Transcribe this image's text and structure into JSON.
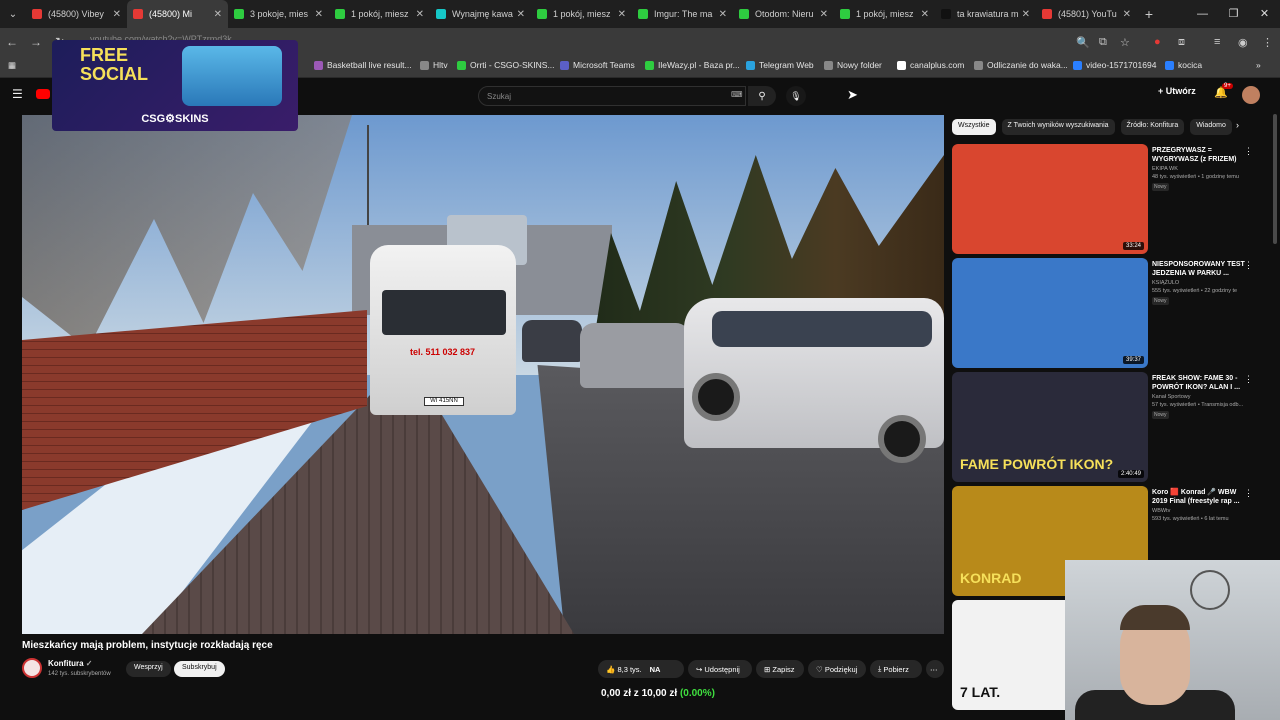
{
  "tabs": [
    {
      "label": "(45800) Vibey",
      "color": "#e53935"
    },
    {
      "label": "(45800) Mi",
      "color": "#e53935",
      "active": true
    },
    {
      "label": "3 pokoje, mies",
      "color": "#2ecc40"
    },
    {
      "label": "1 pokój, miesz",
      "color": "#2ecc40"
    },
    {
      "label": "Wynajmę kawa",
      "color": "#16c7c7"
    },
    {
      "label": "1 pokój, miesz",
      "color": "#2ecc40"
    },
    {
      "label": "Imgur: The ma",
      "color": "#2ecc40"
    },
    {
      "label": "Otodom: Nieru",
      "color": "#2ecc40"
    },
    {
      "label": "1 pokój, miesz",
      "color": "#2ecc40"
    },
    {
      "label": "ta krawiatura m",
      "color": "#111111"
    },
    {
      "label": "(45801) YouTu",
      "color": "#e53935"
    }
  ],
  "address": {
    "url": "youtube.com/watch?v=WPTzrmd3k"
  },
  "bookmarks": [
    {
      "label": "Basketball live result...",
      "color": "#9b59b6"
    },
    {
      "label": "Hltv",
      "color": "#888888"
    },
    {
      "label": "Orrti - CSGO-SKINS...",
      "color": "#2ecc40"
    },
    {
      "label": "Microsoft Teams",
      "color": "#5b5fc7"
    },
    {
      "label": "IleWazy.pl - Baza pr...",
      "color": "#2ecc40"
    },
    {
      "label": "Telegram Web",
      "color": "#2aa3df"
    },
    {
      "label": "Nowy folder",
      "color": "#888888"
    },
    {
      "label": "canalplus.com",
      "color": "#ffffff"
    },
    {
      "label": "Odliczanie do waka...",
      "color": "#888888"
    },
    {
      "label": "video-1571701694",
      "color": "#2a7fff"
    },
    {
      "label": "kocica",
      "color": "#2a7fff"
    }
  ],
  "header": {
    "search_placeholder": "Szukaj",
    "create_label": "Utwórz",
    "notif_count": "9+"
  },
  "video": {
    "title": "Mieszkańcy mają problem, instytucje rozkładają ręce",
    "channel": "Konfitura",
    "subs": "142 tys. subskrybentów",
    "support_label": "Wesprzyj",
    "subscribe_label": "Subskrybuj",
    "likes": "8,3 tys.",
    "share_label": "Udostępnij",
    "save_label": "Zapisz",
    "thanks_label": "Podziękuj",
    "download_label": "Pobierz",
    "van_phone": "tel. 511 032 837",
    "plate": "WI 415NN"
  },
  "donation": {
    "text": "0,00 zł z 10,00 zł",
    "pct": "(0.00%)"
  },
  "chips": [
    "Wszystkie",
    "Z Twoich wyników wyszukiwania",
    "Źródło: Konfitura",
    "Wiadomo"
  ],
  "recs": [
    {
      "title": "PRZEGRYWASZ = WYGRYWASZ (z FRIZEM)",
      "channel": "EKIPA WK",
      "meta": "48 tys. wyświetleń • 1 godzinę temu",
      "new": "Nowy",
      "dur": "33:24",
      "color": "#d9462f"
    },
    {
      "title": "NIESPONSOROWANY TEST JEDZENIA W PARKU ...",
      "channel": "KSIĄŻULO",
      "meta": "555 tys. wyświetleń • 22 godziny te",
      "new": "Nowy",
      "dur": "39:37",
      "color": "#3a78c8"
    },
    {
      "title": "FREAK SHOW: FAME 30 - POWRÓT IKON? ALAN I ...",
      "channel": "Kanał Sportowy",
      "meta": "57 tys. wyświetleń • Transmisja odb...",
      "new": "Nowy",
      "dur": "2:40:49",
      "color": "#2a2a3a",
      "overlay": "FAME POWRÓT IKON?"
    },
    {
      "title": "Koro 🟥 Konrad 🎤 WBW 2019 Final (freestyle rap ...",
      "channel": "WBWtv",
      "meta": "593 tys. wyświetleń • 6 lat temu",
      "new": "",
      "dur": "",
      "color": "#b88a1a",
      "overlay": "KONRAD"
    },
    {
      "title": "",
      "channel": "",
      "meta": "",
      "new": "",
      "dur": "",
      "color": "#f2f2f2",
      "overlay": "7 LAT."
    }
  ],
  "overlay_ad": {
    "line1": "FREE",
    "line2": "SOCIAL",
    "brand": "CSG⚙SKINS"
  }
}
